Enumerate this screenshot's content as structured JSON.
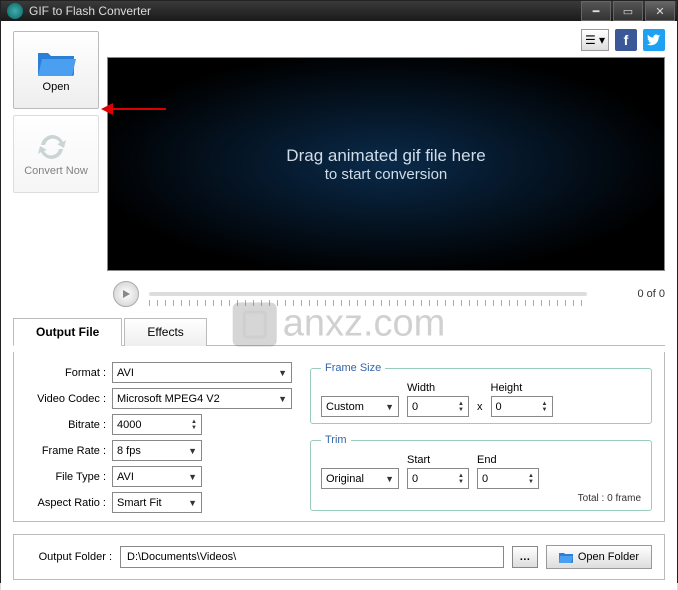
{
  "title": "GIF to Flash Converter",
  "sidebar": {
    "open": "Open",
    "convert": "Convert Now"
  },
  "preview": {
    "line1": "Drag animated gif file here",
    "line2": "to start conversion"
  },
  "player": {
    "counter": "0 of 0"
  },
  "tabs": {
    "output": "Output File",
    "effects": "Effects"
  },
  "labels": {
    "format": "Format :",
    "codec": "Video Codec :",
    "bitrate": "Bitrate :",
    "framerate": "Frame Rate :",
    "filetype": "File Type :",
    "aspect": "Aspect Ratio :",
    "framesize": "Frame Size",
    "width": "Width",
    "height": "Height",
    "trim": "Trim",
    "start": "Start",
    "end": "End",
    "outputfolder": "Output Folder :",
    "openfolder": "Open Folder",
    "total": "Total : 0 frame"
  },
  "values": {
    "format": "AVI",
    "codec": "Microsoft MPEG4 V2",
    "bitrate": "4000",
    "framerate": "8 fps",
    "filetype": "AVI",
    "aspect": "Smart Fit",
    "fs_mode": "Custom",
    "width": "0",
    "height": "0",
    "trim_mode": "Original",
    "start": "0",
    "end": "0",
    "path": "D:\\Documents\\Videos\\"
  },
  "watermark": "anxz.com"
}
